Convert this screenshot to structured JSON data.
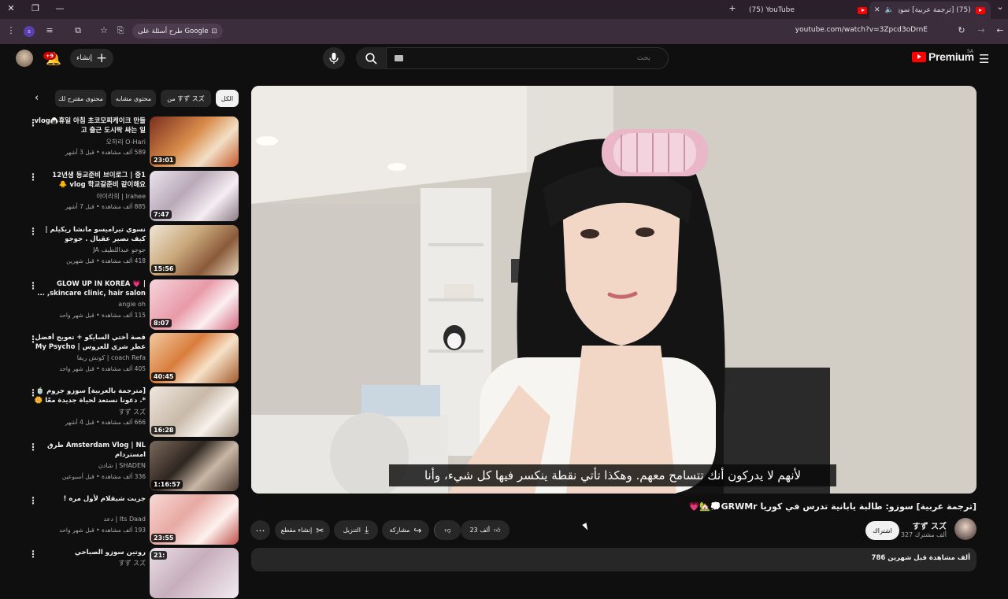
{
  "browser": {
    "tabs": [
      {
        "title": "(75) [ترجمة عربية] سوزو: طا"
      },
      {
        "title": "(75) YouTube"
      }
    ],
    "ask_google": "طرح أسئلة على Google",
    "url": "youtube.com/watch?v=3Zpcd3oDrnE"
  },
  "header": {
    "create": "إنشاء",
    "notifications": "+9",
    "search_placeholder": "بحث",
    "logo": "Premium",
    "region": "SA"
  },
  "chips": [
    "الكل",
    "من すず スズ",
    "محتوى مشابه",
    "محتوى مقترح لك"
  ],
  "recommendations": [
    {
      "title": "vlog🍙휴일 아침 초코모찌케이크 만들고 출근 도시락 싸는 일",
      "channel": "오하리 O-Hari",
      "meta": "589 ألف مشاهدة • قبل 3 أشهر",
      "duration": "23:01"
    },
    {
      "title": "12년생 등교준비 브이로그 | 중1 vlog 학교갈준비 같이해요 🐥",
      "channel": "아이라희 | Irahee",
      "meta": "885 ألف مشاهدة • قبل 7 أشهر",
      "duration": "7:47"
    },
    {
      "title": "نسوي تيراميسو مانشا ريكيلم | كيف نصير عقبال . جوجو عبداللطيف",
      "channel": "جوجو عبداللطيف JA",
      "meta": "418 ألف مشاهدة • قبل شهرين",
      "duration": "15:56"
    },
    {
      "title": "GLOW UP IN KOREA 💗 | skincare clinic, hair salon, ...",
      "channel": "angie oh",
      "meta": "115 ألف مشاهدة • قبل شهر واحد",
      "duration": "8:07"
    },
    {
      "title": "قصة أختي السايكو + تعويج أفضل عطر شري للعروس | My Psycho Sister ...",
      "channel": "coach Refa | كوتش ريفا",
      "meta": "405 ألف مشاهدة • قبل شهر واحد",
      "duration": "40:45"
    },
    {
      "title": "[مترجمة بالعربية] سوزو جروم 🍵*. دعونا نستعد لحياة جديدة معًا 🌼 حتى اليوم",
      "channel": "すず スズ",
      "meta": "666 ألف مشاهدة • قبل 4 أشهر",
      "duration": "16:28"
    },
    {
      "title": "Amsterdam Vlog | NL طرق امستردام",
      "channel": "SHADEN | شادن",
      "meta": "336 ألف مشاهدة • قبل أسبوعين",
      "duration": "1:16:57"
    },
    {
      "title": "جربت شيقلام لأول مره !",
      "channel": "Its Daad | دعد",
      "meta": "193 ألف مشاهدة • قبل شهر واحد",
      "duration": "23:55"
    },
    {
      "title": "روتين سوزو الصباحي",
      "channel": "すず スズ",
      "meta": "",
      "duration": "21:"
    }
  ],
  "player": {
    "subtitle": "لأنهم لا يدركون أنك تتسامح معهم. وهكذا تأتي نقطة ينكسر فيها كل شيء، وأنا"
  },
  "video": {
    "title": "[ترجمة عربية] سوزو: طالبة يابانية تدرس في كوريا GRWMr💭🏡💗",
    "channel": "すず スズ",
    "subscribers": "327 ألف مشترك",
    "subscribe": "اشتراك",
    "likes": "23 ألف",
    "share": "مشاركة",
    "download": "التنزيل",
    "clip": "إنشاء مقطع",
    "description_meta": "786 ألف مشاهدة  قبل شهرين"
  }
}
